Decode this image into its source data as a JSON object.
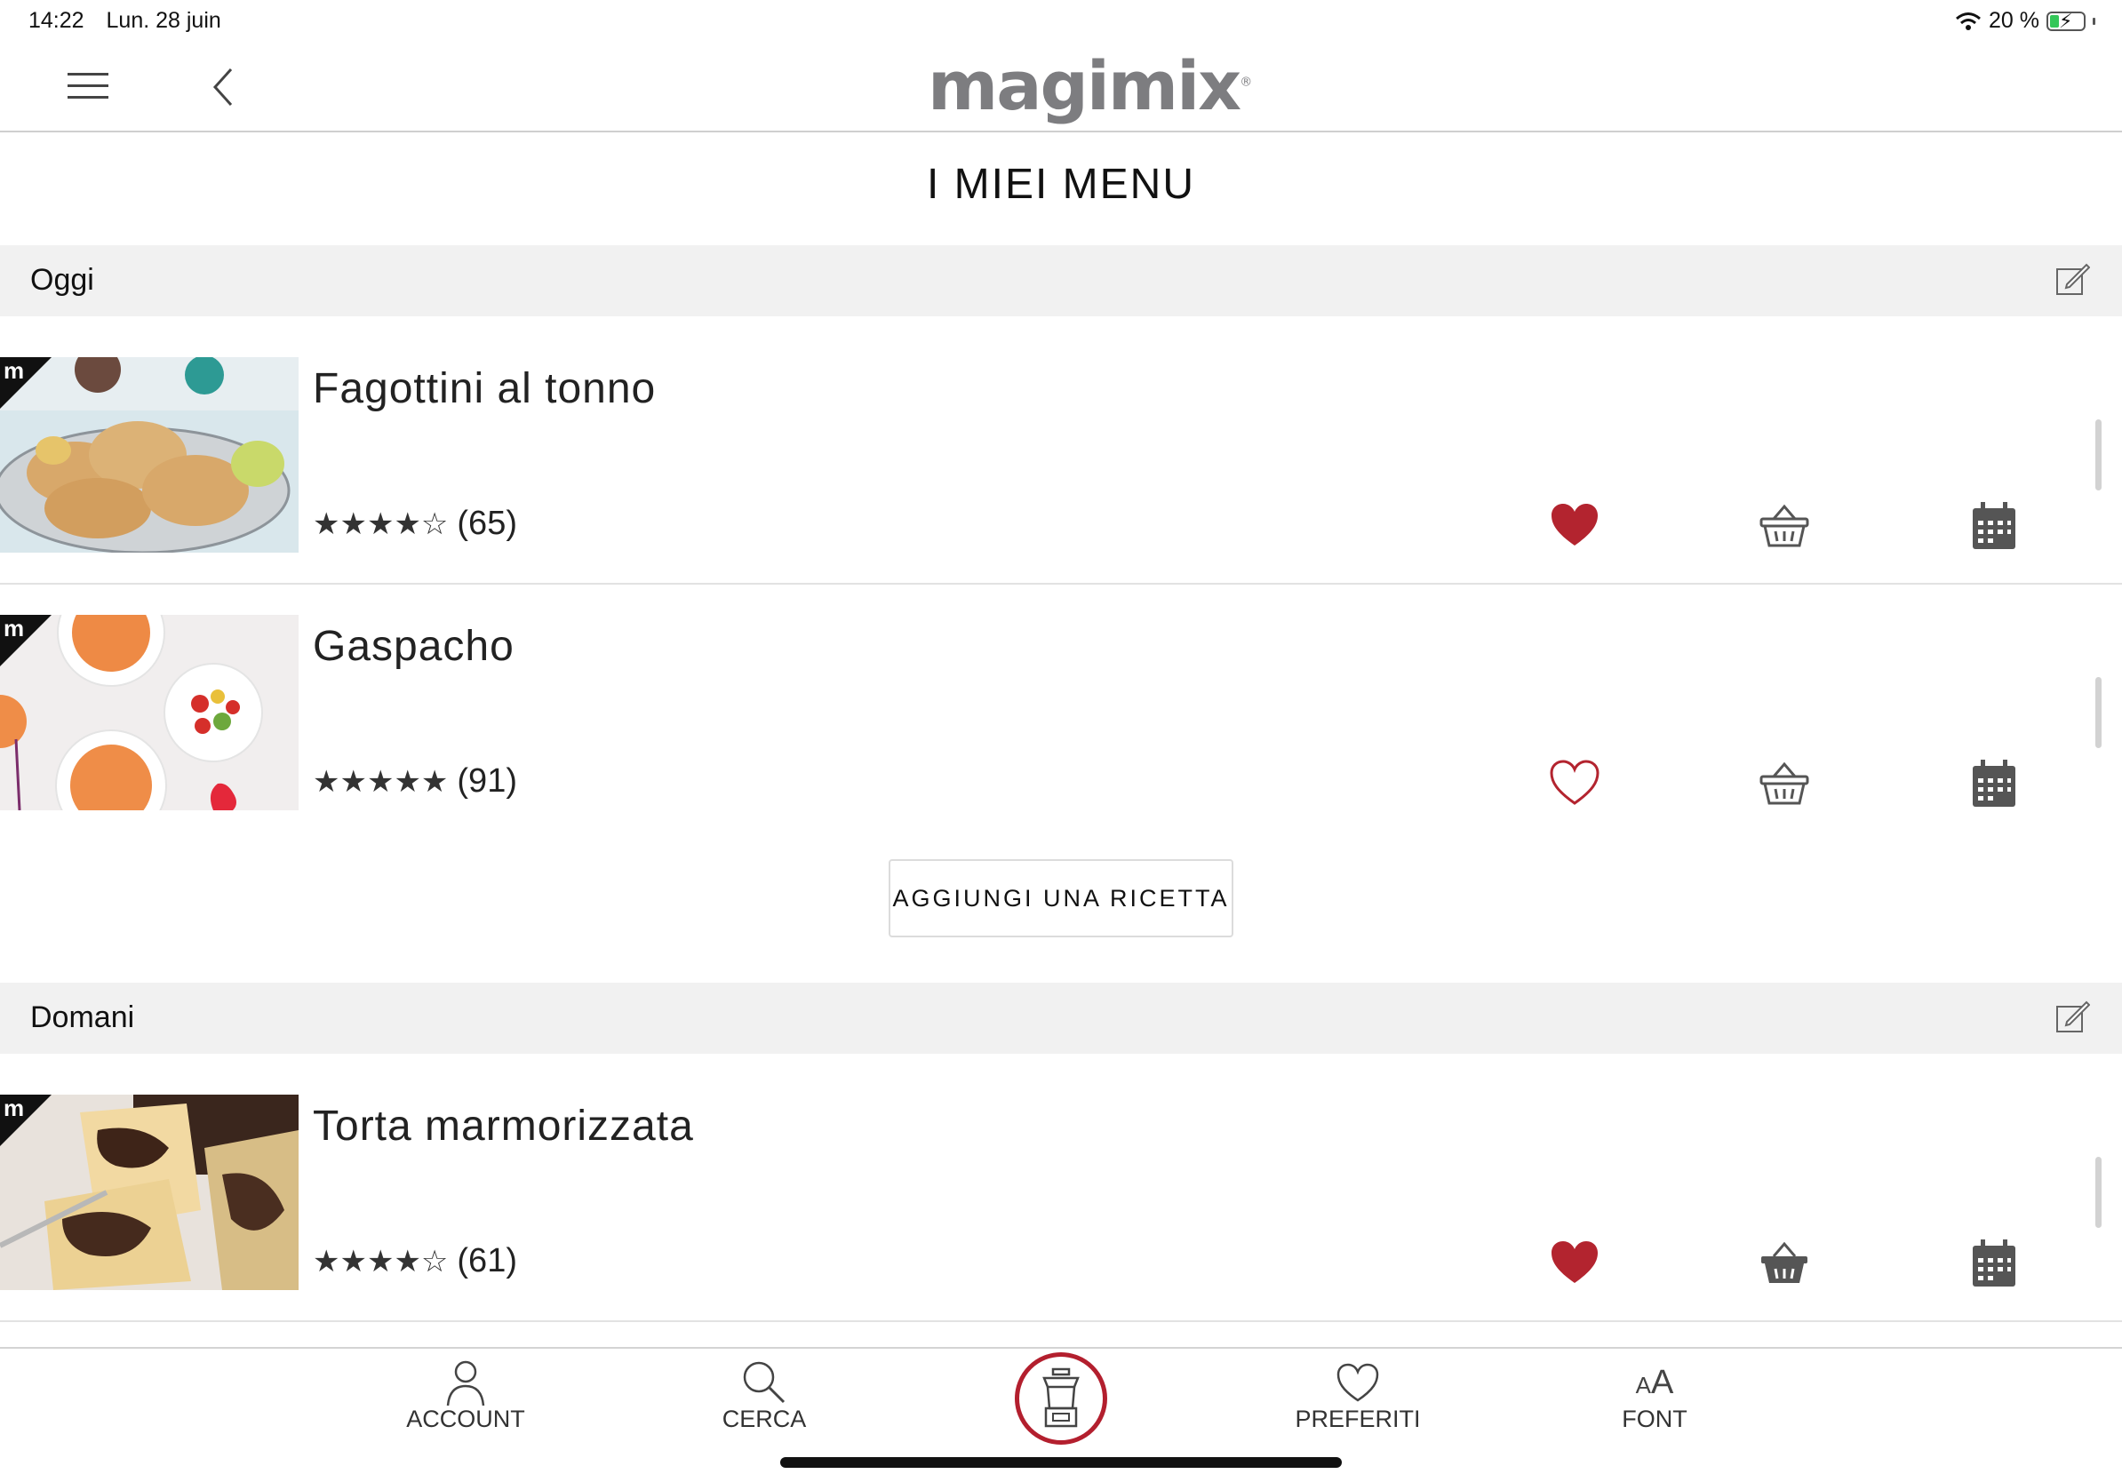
{
  "status_bar": {
    "time": "14:22",
    "date": "Lun. 28 juin",
    "battery": "20 %"
  },
  "header": {
    "logo": "magimix",
    "logo_mark": "®"
  },
  "page_title": "I MIEI MENU",
  "sections": [
    {
      "label": "Oggi",
      "recipes": [
        {
          "name": "Fagottini al tonno",
          "stars": "★★★★☆",
          "reviews": "(65)",
          "favorite": true,
          "badge": "m"
        },
        {
          "name": "Gaspacho",
          "stars": "★★★★★",
          "reviews": "(91)",
          "favorite": false,
          "badge": "m"
        }
      ],
      "add_button": "AGGIUNGI UNA RICETTA"
    },
    {
      "label": "Domani",
      "recipes": [
        {
          "name": "Torta marmorizzata",
          "stars": "★★★★☆",
          "reviews": "(61)",
          "favorite": true,
          "badge": "m"
        }
      ]
    }
  ],
  "tabs": {
    "account": "ACCOUNT",
    "search": "CERCA",
    "favorites": "PREFERITI",
    "font": "FONT",
    "font_glyph": "AA"
  },
  "colors": {
    "accent": "#b31f2e",
    "heart": "#b3242f",
    "icon": "#555555"
  }
}
